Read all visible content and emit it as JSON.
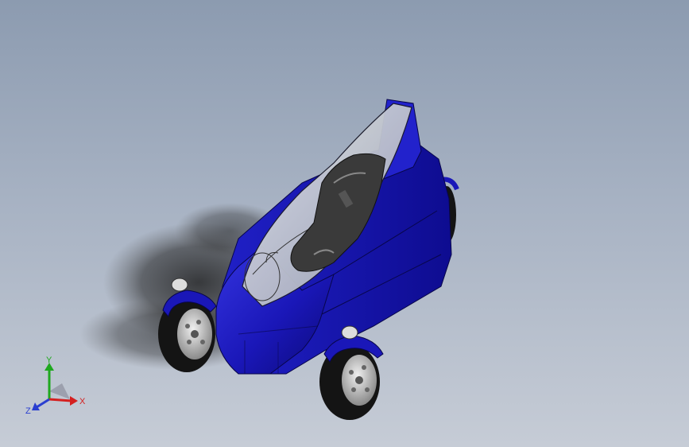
{
  "viewport": {
    "background_top": "#8c9bb0",
    "background_bottom": "#c6ccd6",
    "model": {
      "body_color": "#1a17b8",
      "body_highlight": "#3a3ae0",
      "body_shadow": "#0c0a78",
      "canopy_color": "#c7ccd4",
      "seat_color": "#3a3a3a",
      "tire_color": "#141414",
      "rim_color": "#d0d0d0"
    }
  },
  "triad": {
    "x_label": "X",
    "y_label": "Y",
    "z_label": "Z",
    "x_color": "#d42020",
    "y_color": "#1fa81f",
    "z_color": "#2a3fd0",
    "x_icon": "x-axis-arrow",
    "y_icon": "y-axis-arrow",
    "z_icon": "z-axis-arrow"
  }
}
